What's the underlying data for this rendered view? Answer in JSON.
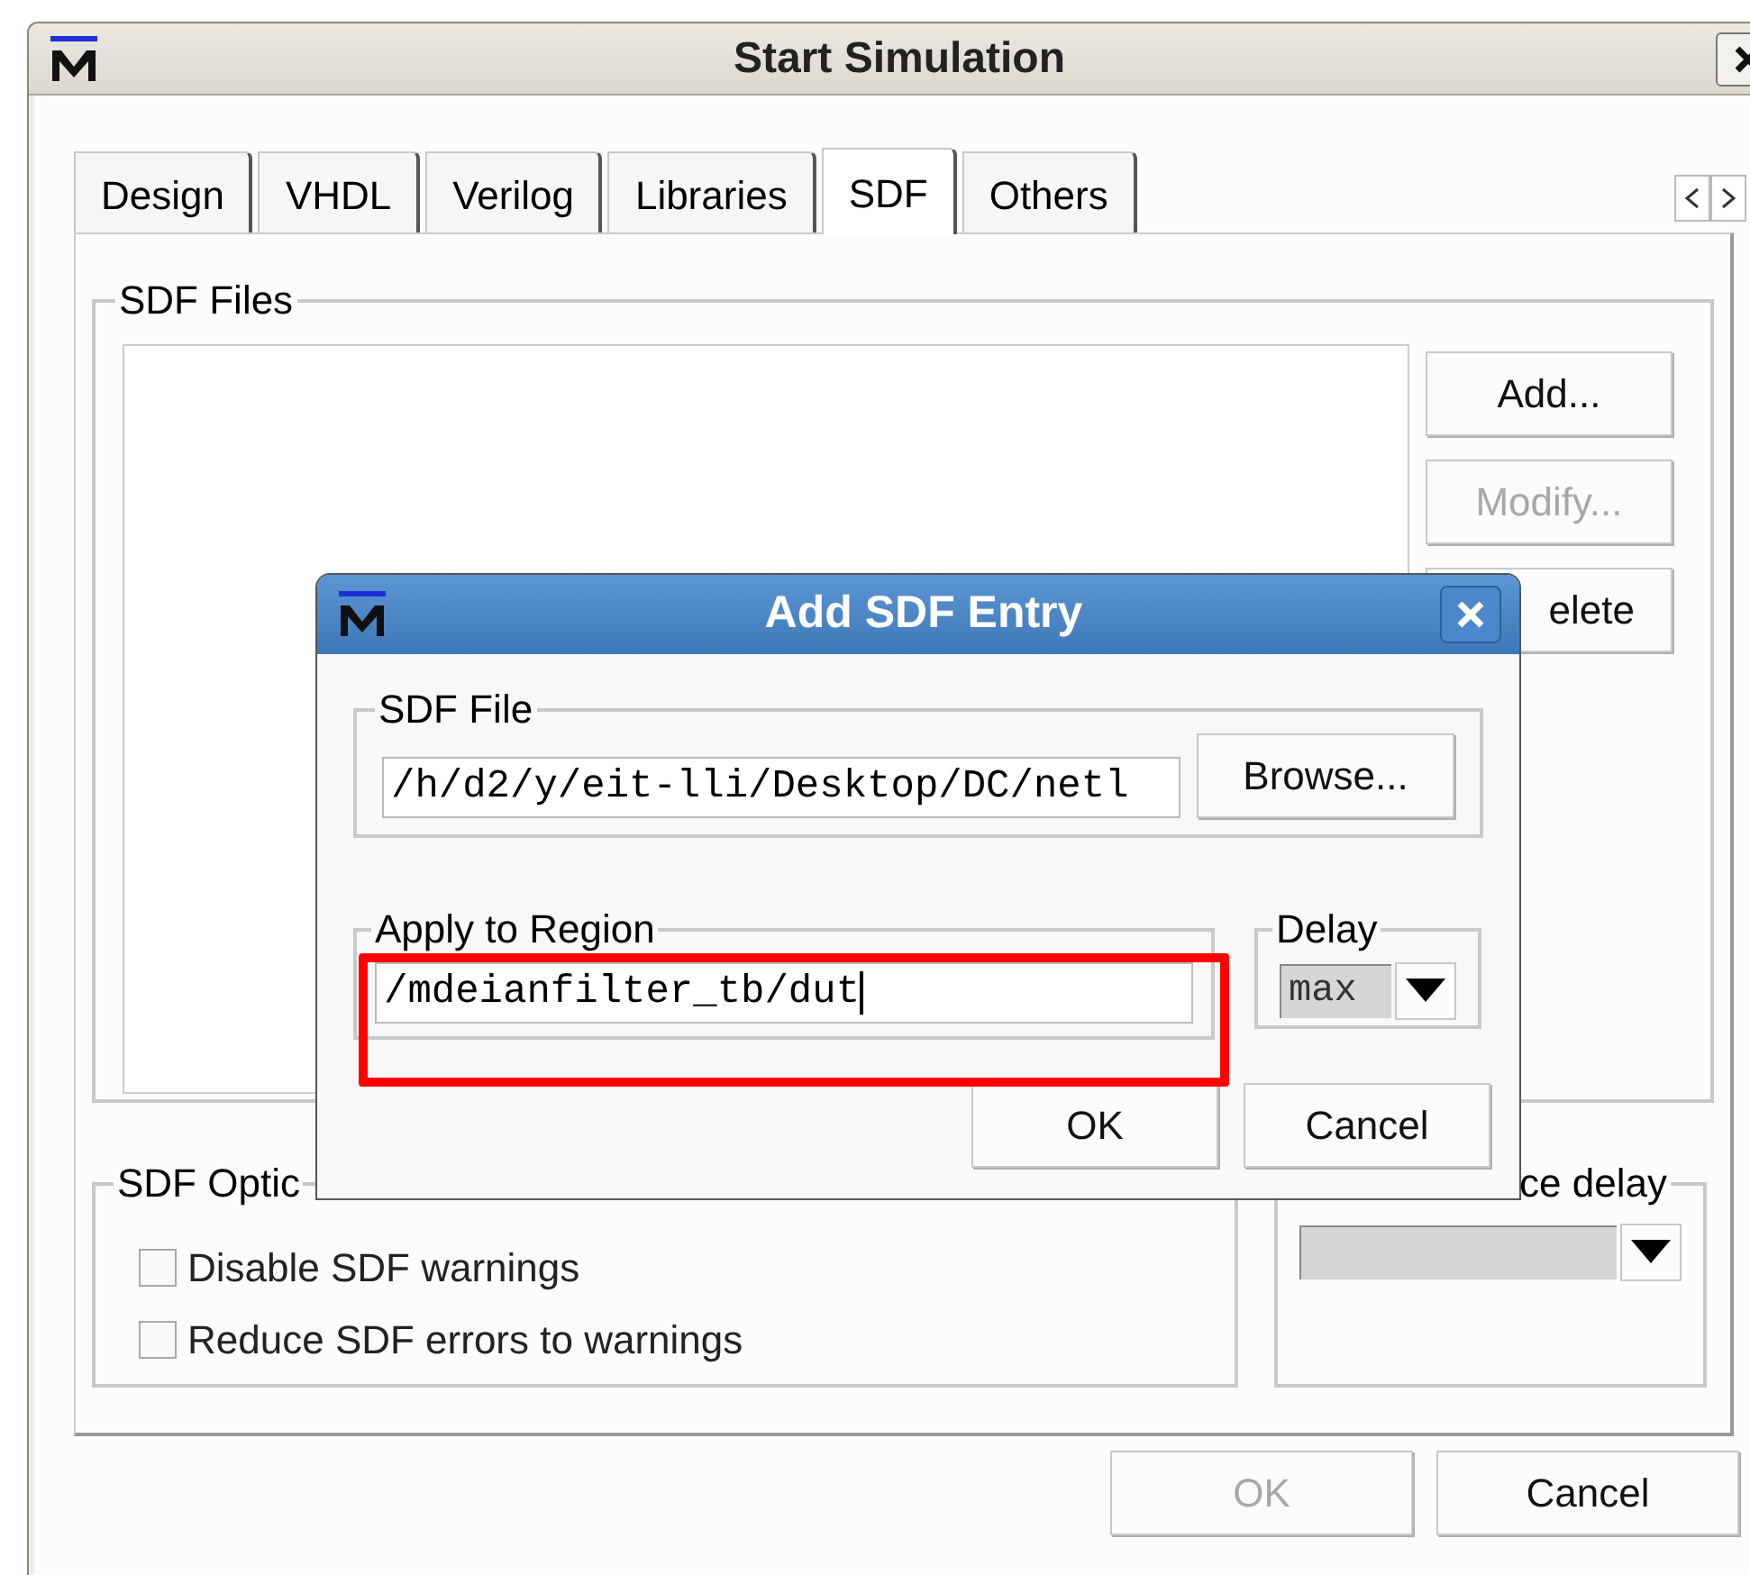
{
  "window": {
    "title": "Start Simulation"
  },
  "tabs": [
    {
      "label": "Design",
      "selected": false
    },
    {
      "label": "VHDL",
      "selected": false
    },
    {
      "label": "Verilog",
      "selected": false
    },
    {
      "label": "Libraries",
      "selected": false
    },
    {
      "label": "SDF",
      "selected": true
    },
    {
      "label": "Others",
      "selected": false
    }
  ],
  "sdf_files": {
    "legend": "SDF Files",
    "buttons": [
      {
        "label": "Add...",
        "disabled": false
      },
      {
        "label": "Modify...",
        "disabled": true
      },
      {
        "label": "elete",
        "disabled": false
      }
    ]
  },
  "sdf_options": {
    "legend": "SDF Optic",
    "checkboxes": [
      {
        "label": "Disable SDF warnings",
        "checked": false
      },
      {
        "label": "Reduce SDF errors to warnings",
        "checked": false
      }
    ]
  },
  "delay_group": {
    "legend": "ce delay"
  },
  "footer_buttons": [
    {
      "label": "OK",
      "disabled": true
    },
    {
      "label": "Cancel",
      "disabled": false
    }
  ],
  "dialog": {
    "title": "Add SDF Entry",
    "sdf_file": {
      "legend": "SDF File",
      "value": "/h/d2/y/eit-lli/Desktop/DC/netl",
      "browse": "Browse..."
    },
    "region": {
      "legend": "Apply to Region",
      "value": "/mdeianfilter_tb/dut"
    },
    "delay": {
      "legend": "Delay",
      "value": "max"
    },
    "buttons": [
      "OK",
      "Cancel"
    ]
  }
}
